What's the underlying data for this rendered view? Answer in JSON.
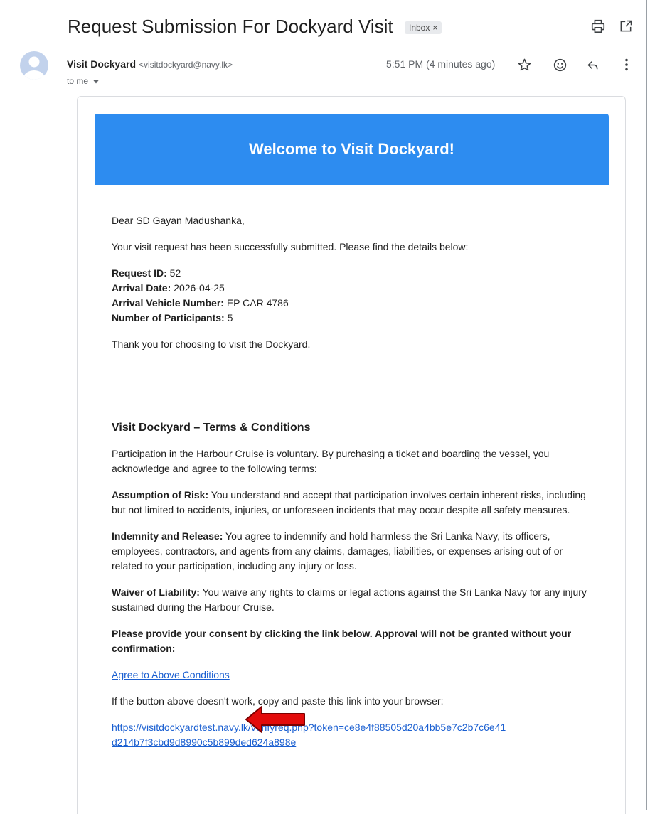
{
  "email": {
    "subject": "Request Submission For Dockyard Visit",
    "label_chip": "Inbox",
    "label_chip_close": "×",
    "sender_name": "Visit Dockyard",
    "sender_email": "<visitdockyard@navy.lk>",
    "recipient": "to me",
    "timestamp": "5:51 PM (4 minutes ago)"
  },
  "toolbar_icons": [
    "print-icon",
    "open-in-new-window-icon",
    "star-icon",
    "emoji-icon",
    "reply-icon",
    "more-vertical-icon"
  ],
  "body": {
    "banner_title": "Welcome to Visit Dockyard!",
    "greeting": "Dear SD Gayan Madushanka,",
    "intro": "Your visit request has been successfully submitted. Please find the details below:",
    "details": [
      {
        "label": "Request ID:",
        "value": " 52"
      },
      {
        "label": "Arrival Date:",
        "value": " 2026-04-25"
      },
      {
        "label": "Arrival Vehicle Number:",
        "value": " EP CAR 4786"
      },
      {
        "label": "Number of Participants:",
        "value": " 5"
      }
    ],
    "thanks": "Thank you for choosing to visit the Dockyard.",
    "terms_heading": "Visit Dockyard – Terms & Conditions",
    "terms_intro": "Participation in the Harbour Cruise is voluntary. By purchasing a ticket and boarding the vessel, you acknowledge and agree to the following terms:",
    "terms": [
      {
        "label": "Assumption of Risk:",
        "text": " You understand and accept that participation involves certain inherent risks, including but not limited to accidents, injuries, or unforeseen incidents that may occur despite all safety measures."
      },
      {
        "label": "Indemnity and Release:",
        "text": " You agree to indemnify and hold harmless the Sri Lanka Navy, its officers, employees, contractors, and agents from any claims, damages, liabilities, or expenses arising out of or related to your participation, including any injury or loss."
      },
      {
        "label": "Waiver of Liability:",
        "text": " You waive any rights to claims or legal actions against the Sri Lanka Navy for any injury sustained during the Harbour Cruise."
      }
    ],
    "consent_prompt": "Please provide your consent by clicking the link below. Approval will not be granted without your confirmation:",
    "agree_link": "Agree to Above Conditions",
    "fallback_text": "If the button above doesn't work, copy and paste this link into your browser:",
    "verify_url_line1": "https://visitdockyardtest.navy.lk/verifyreq.php?token=ce8e4f88505d20a4bb5e7c2b7c6e41",
    "verify_url_line2": "d214b7f3cbd9d8990c5b899ded624a898e"
  },
  "colors": {
    "banner": "#2d8cf0",
    "link": "#1a5fd1",
    "annotation_arrow": "#e30b0b"
  }
}
